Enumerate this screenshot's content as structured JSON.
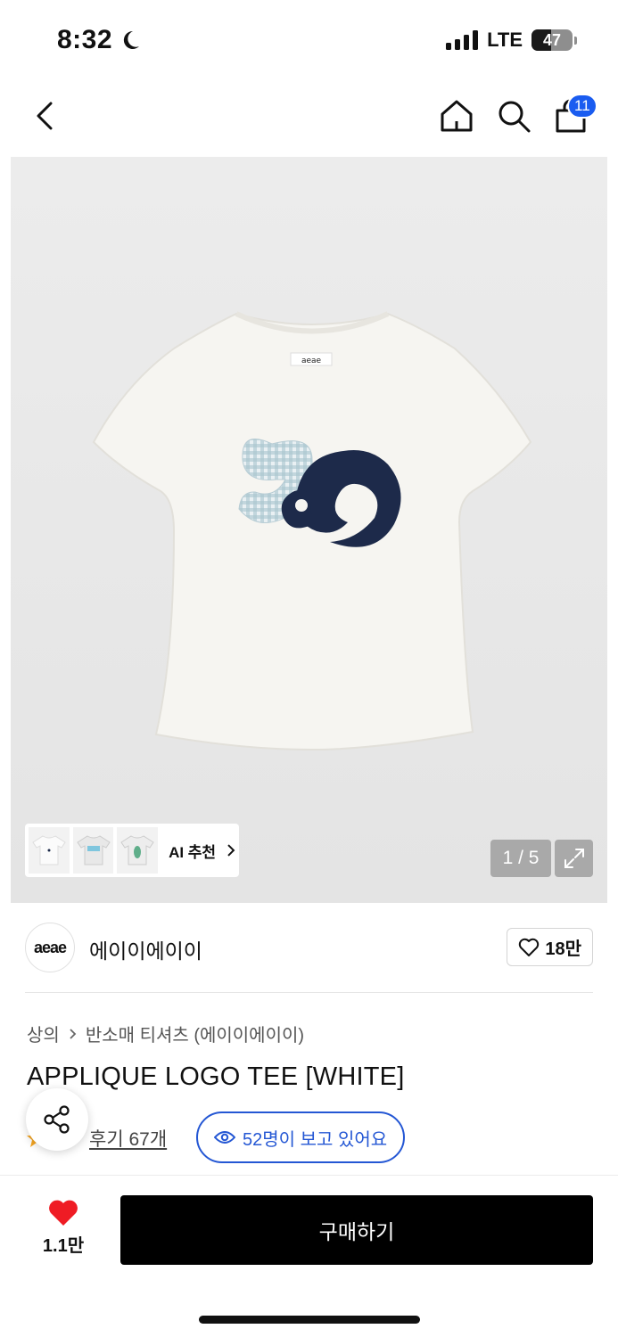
{
  "status_bar": {
    "time": "8:32",
    "network": "LTE",
    "battery": "47",
    "battery_level": 0.47
  },
  "nav": {
    "cart_count": "11",
    "icons": [
      "back-icon",
      "home-icon",
      "search-icon",
      "shopping-bag-icon"
    ]
  },
  "gallery": {
    "ai_label": "AI 추천",
    "page_indicator": "1 / 5"
  },
  "brand": {
    "logo_text": "aeae",
    "name": "에이이에이이",
    "likes": "18만"
  },
  "breadcrumb": {
    "category": "상의",
    "subcategory": "반소매 티셔츠 (에이이에이이)"
  },
  "product": {
    "title": "APPLIQUE LOGO TEE [WHITE]",
    "review_link": "후기 67개",
    "viewers": "52명이 보고 있어요",
    "logo_text": "aeae"
  },
  "bottom": {
    "wish_count": "1.1만",
    "buy_label": "구매하기"
  },
  "colors": {
    "accent_blue": "#2457d4",
    "badge_blue": "#1a5cf0",
    "heart_red": "#ef1c24",
    "buy_button": "#000000"
  }
}
